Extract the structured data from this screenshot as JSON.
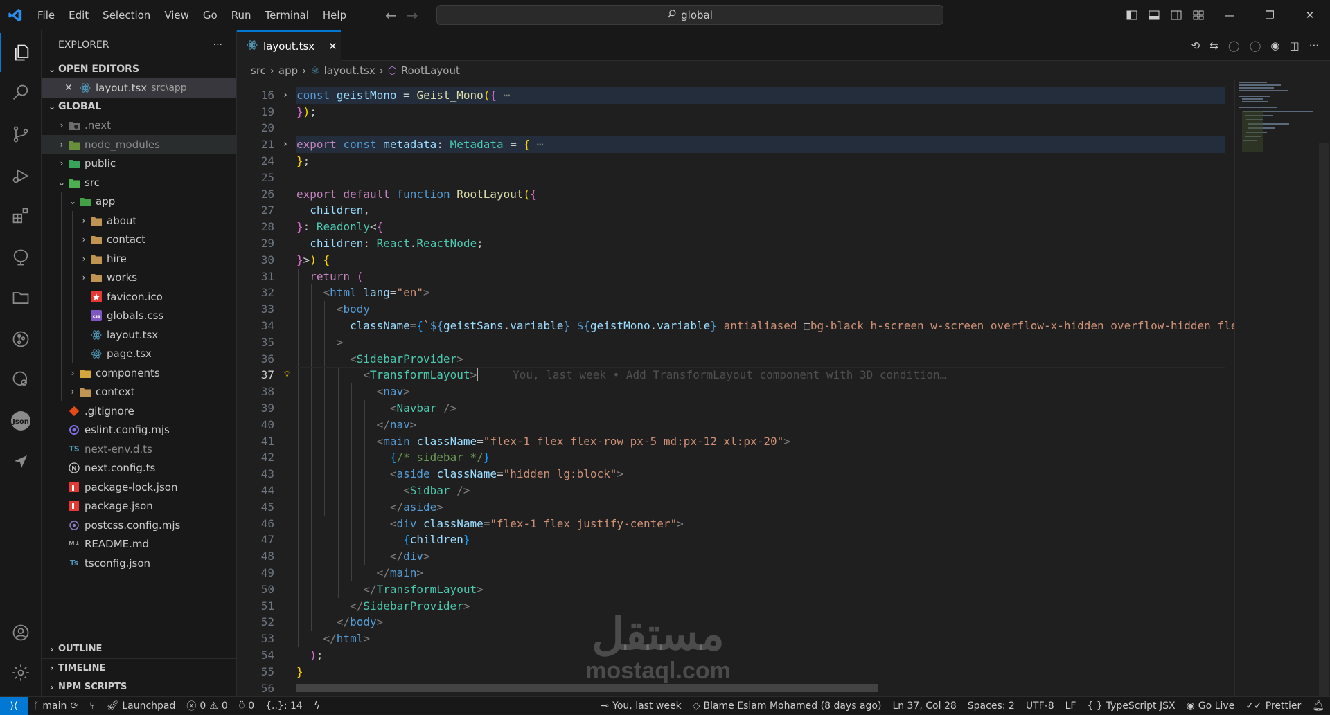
{
  "menu": [
    "File",
    "Edit",
    "Selection",
    "View",
    "Go",
    "Run",
    "Terminal",
    "Help"
  ],
  "search": {
    "text": "global"
  },
  "explorer": {
    "title": "EXPLORER",
    "open_editors_label": "OPEN EDITORS",
    "open_editor": {
      "name": "layout.tsx",
      "path": "src\\app"
    },
    "root_label": "GLOBAL",
    "tree": [
      {
        "name": ".next",
        "depth": 1,
        "type": "folder",
        "chev": "›",
        "icon": "next",
        "dim": true
      },
      {
        "name": "node_modules",
        "depth": 1,
        "type": "folder",
        "chev": "›",
        "icon": "node",
        "dim": true,
        "hover": true
      },
      {
        "name": "public",
        "depth": 1,
        "type": "folder",
        "chev": "›",
        "icon": "public"
      },
      {
        "name": "src",
        "depth": 1,
        "type": "folder",
        "chev": "⌄",
        "icon": "src"
      },
      {
        "name": "app",
        "depth": 2,
        "type": "folder",
        "chev": "⌄",
        "icon": "app"
      },
      {
        "name": "about",
        "depth": 3,
        "type": "folder",
        "chev": "›",
        "icon": "folder"
      },
      {
        "name": "contact",
        "depth": 3,
        "type": "folder",
        "chev": "›",
        "icon": "folder"
      },
      {
        "name": "hire",
        "depth": 3,
        "type": "folder",
        "chev": "›",
        "icon": "folder"
      },
      {
        "name": "works",
        "depth": 3,
        "type": "folder",
        "chev": "›",
        "icon": "folder"
      },
      {
        "name": "favicon.ico",
        "depth": 3,
        "type": "file",
        "icon": "favicon"
      },
      {
        "name": "globals.css",
        "depth": 3,
        "type": "file",
        "icon": "css"
      },
      {
        "name": "layout.tsx",
        "depth": 3,
        "type": "file",
        "icon": "react"
      },
      {
        "name": "page.tsx",
        "depth": 3,
        "type": "file",
        "icon": "react"
      },
      {
        "name": "components",
        "depth": 2,
        "type": "folder",
        "chev": "›",
        "icon": "components"
      },
      {
        "name": "context",
        "depth": 2,
        "type": "folder",
        "chev": "›",
        "icon": "folder"
      },
      {
        "name": ".gitignore",
        "depth": 1,
        "type": "file",
        "icon": "git"
      },
      {
        "name": "eslint.config.mjs",
        "depth": 1,
        "type": "file",
        "icon": "eslint"
      },
      {
        "name": "next-env.d.ts",
        "depth": 1,
        "type": "file",
        "icon": "ts",
        "dim": true
      },
      {
        "name": "next.config.ts",
        "depth": 1,
        "type": "file",
        "icon": "nextcfg"
      },
      {
        "name": "package-lock.json",
        "depth": 1,
        "type": "file",
        "icon": "npm"
      },
      {
        "name": "package.json",
        "depth": 1,
        "type": "file",
        "icon": "npm"
      },
      {
        "name": "postcss.config.mjs",
        "depth": 1,
        "type": "file",
        "icon": "postcss"
      },
      {
        "name": "README.md",
        "depth": 1,
        "type": "file",
        "icon": "md"
      },
      {
        "name": "tsconfig.json",
        "depth": 1,
        "type": "file",
        "icon": "tsconfig"
      }
    ],
    "bottom": [
      "OUTLINE",
      "TIMELINE",
      "NPM SCRIPTS"
    ]
  },
  "tab": {
    "name": "layout.tsx"
  },
  "breadcrumb": [
    "src",
    "app",
    "layout.tsx",
    "RootLayout"
  ],
  "editor": {
    "current_line": 37,
    "blame_inline": "You, last week • Add TransformLayout component with 3D condition…",
    "lines": [
      {
        "n": "16",
        "fold": true,
        "hl": true,
        "html": "<span class='k'>const</span> <span class='v'>geistMono</span> <span class='p'>=</span> <span class='f'>Geist_Mono</span><span class='g1'>(</span><span class='g2'>{</span> <span class='tg'>⋯</span>"
      },
      {
        "n": "19",
        "html": "<span class='g2'>}</span><span class='g1'>)</span><span class='p'>;</span>"
      },
      {
        "n": "20",
        "html": ""
      },
      {
        "n": "21",
        "fold": true,
        "hl": true,
        "html": "<span class='ret'>export</span> <span class='k'>const</span> <span class='v'>metadata</span><span class='p'>:</span> <span class='t'>Metadata</span> <span class='p'>=</span> <span class='g1'>{</span> <span class='tg'>⋯</span>"
      },
      {
        "n": "24",
        "html": "<span class='g1'>}</span><span class='p'>;</span>"
      },
      {
        "n": "25",
        "html": ""
      },
      {
        "n": "26",
        "html": "<span class='ret'>export</span> <span class='ret'>default</span> <span class='k'>function</span> <span class='f'>RootLayout</span><span class='g1'>(</span><span class='g2'>{</span>"
      },
      {
        "n": "27",
        "html": "  <span class='v'>children</span><span class='p'>,</span>"
      },
      {
        "n": "28",
        "html": "<span class='g2'>}</span><span class='p'>:</span> <span class='t'>Readonly</span><span class='p'>&lt;</span><span class='g2'>{</span>"
      },
      {
        "n": "29",
        "html": "  <span class='v'>children</span><span class='p'>:</span> <span class='t'>React</span><span class='p'>.</span><span class='t'>ReactNode</span><span class='p'>;</span>"
      },
      {
        "n": "30",
        "html": "<span class='g2'>}</span><span class='p'>&gt;</span><span class='g1'>)</span> <span class='g1'>{</span>"
      },
      {
        "n": "31",
        "html": "  <span class='ret'>return</span> <span class='g2'>(</span>"
      },
      {
        "n": "32",
        "html": "    <span class='tg'>&lt;</span><span class='k'>html</span> <span class='v'>lang</span><span class='p'>=</span><span class='s'>\"en\"</span><span class='tg'>&gt;</span>"
      },
      {
        "n": "33",
        "html": "      <span class='tg'>&lt;</span><span class='k'>body</span>"
      },
      {
        "n": "34",
        "html": "        <span class='v'>className</span><span class='p'>=</span><span class='g3'>{</span><span class='s'>`</span><span class='k'>${</span><span class='v'>geistSans</span><span class='p'>.</span><span class='v'>variable</span><span class='k'>}</span> <span class='k'>${</span><span class='v'>geistMono</span><span class='p'>.</span><span class='v'>variable</span><span class='k'>}</span><span class='s'> antialiased </span><span class='p'>□</span><span class='s'>bg-black h-screen w-screen overflow-x-hidden overflow-hidden flex flex-col</span>"
      },
      {
        "n": "35",
        "html": "      <span class='tg'>&gt;</span>"
      },
      {
        "n": "36",
        "html": "        <span class='tg'>&lt;</span><span class='t'>SidebarProvider</span><span class='tg'>&gt;</span>"
      },
      {
        "n": "37",
        "cur": true,
        "bulb": true,
        "html": "          <span class='tg'>&lt;</span><span class='t'>TransformLayout</span><span class='tg'>&gt;</span>"
      },
      {
        "n": "38",
        "html": "            <span class='tg'>&lt;</span><span class='k'>nav</span><span class='tg'>&gt;</span>"
      },
      {
        "n": "39",
        "html": "              <span class='tg'>&lt;</span><span class='t'>Navbar</span> <span class='tg'>/&gt;</span>"
      },
      {
        "n": "40",
        "html": "            <span class='tg'>&lt;/</span><span class='k'>nav</span><span class='tg'>&gt;</span>"
      },
      {
        "n": "41",
        "html": "            <span class='tg'>&lt;</span><span class='k'>main</span> <span class='v'>className</span><span class='p'>=</span><span class='s'>\"flex-1 flex flex-row px-5 md:px-12 xl:px-20\"</span><span class='tg'>&gt;</span>"
      },
      {
        "n": "42",
        "html": "              <span class='g3'>{</span><span class='c'>/* sidebar */</span><span class='g3'>}</span>"
      },
      {
        "n": "43",
        "html": "              <span class='tg'>&lt;</span><span class='k'>aside</span> <span class='v'>className</span><span class='p'>=</span><span class='s'>\"hidden lg:block\"</span><span class='tg'>&gt;</span>"
      },
      {
        "n": "44",
        "html": "                <span class='tg'>&lt;</span><span class='t'>Sidbar</span> <span class='tg'>/&gt;</span>"
      },
      {
        "n": "45",
        "html": "              <span class='tg'>&lt;/</span><span class='k'>aside</span><span class='tg'>&gt;</span>"
      },
      {
        "n": "46",
        "html": "              <span class='tg'>&lt;</span><span class='k'>div</span> <span class='v'>className</span><span class='p'>=</span><span class='s'>\"flex-1 flex justify-center\"</span><span class='tg'>&gt;</span>"
      },
      {
        "n": "47",
        "html": "                <span class='g3'>{</span><span class='v'>children</span><span class='g3'>}</span>"
      },
      {
        "n": "48",
        "html": "              <span class='tg'>&lt;/</span><span class='k'>div</span><span class='tg'>&gt;</span>"
      },
      {
        "n": "49",
        "html": "            <span class='tg'>&lt;/</span><span class='k'>main</span><span class='tg'>&gt;</span>"
      },
      {
        "n": "50",
        "html": "          <span class='tg'>&lt;/</span><span class='t'>TransformLayout</span><span class='tg'>&gt;</span>"
      },
      {
        "n": "51",
        "html": "        <span class='tg'>&lt;/</span><span class='t'>SidebarProvider</span><span class='tg'>&gt;</span>"
      },
      {
        "n": "52",
        "html": "      <span class='tg'>&lt;/</span><span class='k'>body</span><span class='tg'>&gt;</span>"
      },
      {
        "n": "53",
        "html": "    <span class='tg'>&lt;/</span><span class='k'>html</span><span class='tg'>&gt;</span>"
      },
      {
        "n": "54",
        "html": "  <span class='g2'>)</span><span class='p'>;</span>"
      },
      {
        "n": "55",
        "html": "<span class='g1'>}</span>"
      },
      {
        "n": "56",
        "html": ""
      }
    ]
  },
  "status": {
    "branch": "main",
    "launchpad": "Launchpad",
    "errors": "0",
    "warnings": "0",
    "ports": "0",
    "symbols": "{..}: 14",
    "blame_author": "You, last week",
    "blame": "Blame Eslam Mohamed (8 days ago)",
    "position": "Ln 37, Col 28",
    "spaces": "Spaces: 2",
    "encoding": "UTF-8",
    "eol": "LF",
    "language": "TypeScript JSX",
    "golive": "Go Live",
    "prettier": "Prettier"
  },
  "watermark": {
    "arabic": "مستقل",
    "latin": "mostaql.com"
  },
  "colors": {
    "accent": "#0078d4",
    "background": "#1f1f1f",
    "sidebar": "#181818"
  }
}
